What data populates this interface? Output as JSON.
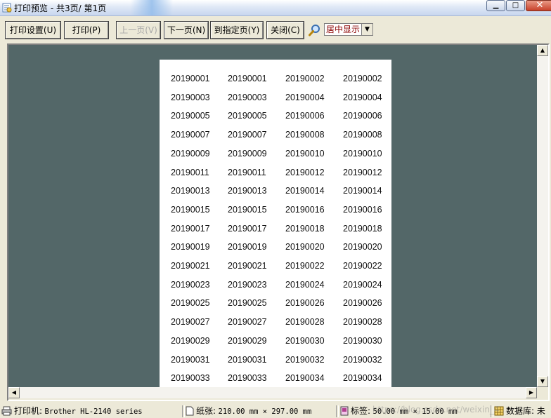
{
  "window": {
    "title": "打印预览 - 共3页/ 第1页",
    "min_glyph": "▁",
    "max_glyph": "□",
    "close_glyph": "✕"
  },
  "toolbar": {
    "print_setup": "打印设置(U)",
    "print": "打印(P)",
    "prev_page": "上一页(V)",
    "next_page": "下一页(N)",
    "goto_page": "到指定页(Y)",
    "close": "关闭(C)",
    "zoom_icon": "magnifier-icon",
    "center_display": "居中显示"
  },
  "labels": [
    [
      "20190001",
      "20190001",
      "20190002",
      "20190002"
    ],
    [
      "20190003",
      "20190003",
      "20190004",
      "20190004"
    ],
    [
      "20190005",
      "20190005",
      "20190006",
      "20190006"
    ],
    [
      "20190007",
      "20190007",
      "20190008",
      "20190008"
    ],
    [
      "20190009",
      "20190009",
      "20190010",
      "20190010"
    ],
    [
      "20190011",
      "20190011",
      "20190012",
      "20190012"
    ],
    [
      "20190013",
      "20190013",
      "20190014",
      "20190014"
    ],
    [
      "20190015",
      "20190015",
      "20190016",
      "20190016"
    ],
    [
      "20190017",
      "20190017",
      "20190018",
      "20190018"
    ],
    [
      "20190019",
      "20190019",
      "20190020",
      "20190020"
    ],
    [
      "20190021",
      "20190021",
      "20190022",
      "20190022"
    ],
    [
      "20190023",
      "20190023",
      "20190024",
      "20190024"
    ],
    [
      "20190025",
      "20190025",
      "20190026",
      "20190026"
    ],
    [
      "20190027",
      "20190027",
      "20190028",
      "20190028"
    ],
    [
      "20190029",
      "20190029",
      "20190030",
      "20190030"
    ],
    [
      "20190031",
      "20190031",
      "20190032",
      "20190032"
    ],
    [
      "20190033",
      "20190033",
      "20190034",
      "20190034"
    ]
  ],
  "status": {
    "printer_label": "打印机:",
    "printer_value": "Brother HL-2140 series",
    "paper_label": "纸张:",
    "paper_value": "210.00 mm × 297.00 mm",
    "tag_label": "标签:",
    "tag_value": "50.00 mm × 15.00 mm",
    "db_label": "数据库: 未"
  },
  "watermark": "https://blog.csdn.net/weixin_4..."
}
